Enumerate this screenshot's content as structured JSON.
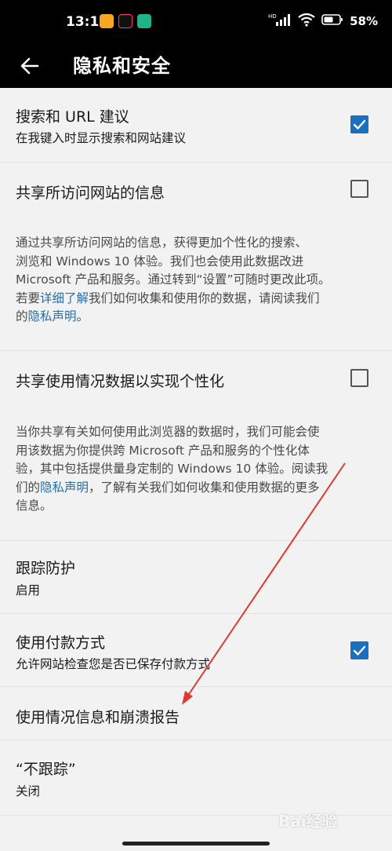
{
  "status_bar": {
    "time": "13:14",
    "network_label": "HD",
    "battery": "58%",
    "notification_icons": [
      "chat-icon",
      "tiktok-icon",
      "settings-app-icon"
    ]
  },
  "header": {
    "back_icon": "back-arrow-icon",
    "title": "隐私和安全"
  },
  "settings": {
    "search_suggestions": {
      "title": "搜索和 URL 建议",
      "subtitle": "在我键入时显示搜索和网站建议",
      "checked": true
    },
    "share_sites": {
      "title": "共享所访问网站的信息",
      "checked": false,
      "desc": {
        "line1": "通过共享所访问网站的信息，获得更加个性化的搜索、",
        "line2": "浏览和 Windows 10 体验。我们也会使用此数据改进",
        "line3": "Microsoft 产品和服务。通过转到“设置”可随时更改此项。",
        "line4_pre": "若要",
        "line4_link": "详细了解",
        "line4_post": "我们如何收集和使用你的数据，请阅读我们",
        "line5_pre": "的",
        "line5_link": "隐私声明",
        "line5_post": "。"
      }
    },
    "share_usage": {
      "title": "共享使用情况数据以实现个性化",
      "checked": false,
      "desc": {
        "line1": "当你共享有关如何使用此浏览器的数据时，我们可能会使",
        "line2": "用该数据为你提供跨 Microsoft 产品和服务的个性化体",
        "line3": "验，其中包括提供量身定制的 Windows 10 体验。阅读我",
        "line4_pre": "们的",
        "line4_link": "隐私声明",
        "line4_post": "，了解有关我们如何收集和使用数据的更多",
        "line5": "信息。"
      }
    },
    "tracking_prevention": {
      "title": "跟踪防护",
      "value": "启用"
    },
    "payment_methods": {
      "title": "使用付款方式",
      "subtitle": "允许网站检查您是否已保存付款方式",
      "checked": true
    },
    "crash_reports": {
      "title": "使用情况信息和崩溃报告"
    },
    "do_not_track": {
      "title": "“不跟踪”",
      "value": "关闭"
    }
  },
  "watermark": "Bai经验",
  "colors": {
    "accent": "#1a6fbf",
    "link": "#1f6fb5",
    "annotation_arrow": "#e03a2e",
    "header_bg": "#000000",
    "page_bg": "#f2f2f2"
  }
}
